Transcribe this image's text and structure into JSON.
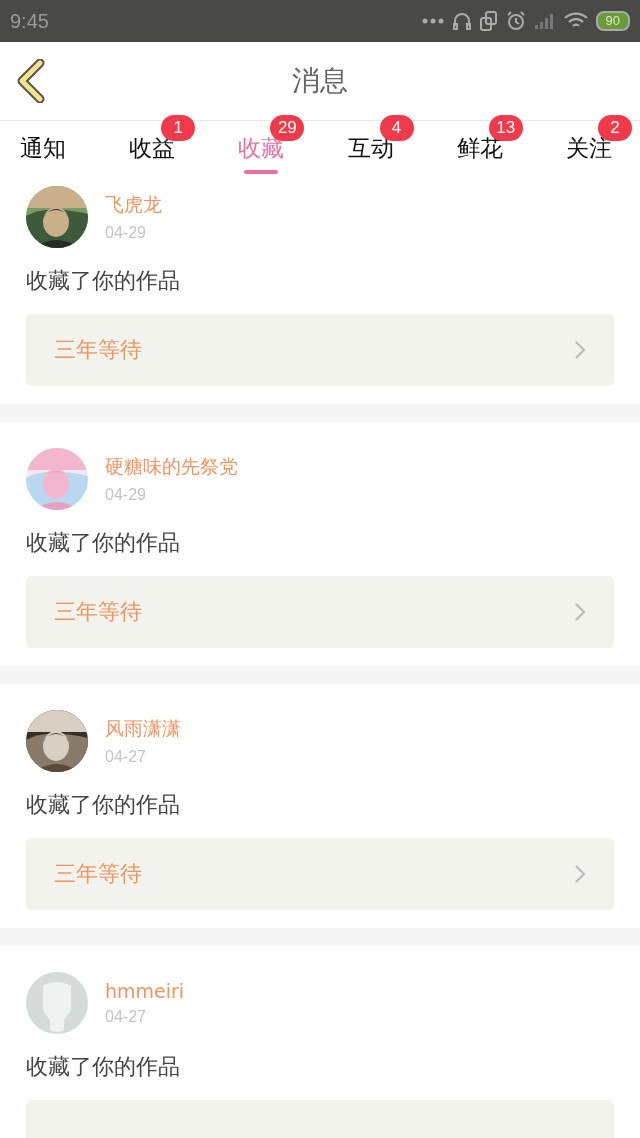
{
  "status_bar": {
    "time": "9:45",
    "battery": "90"
  },
  "header": {
    "title": "消息"
  },
  "tabs": [
    {
      "label": "通知",
      "selected": false
    },
    {
      "label": "收益",
      "selected": false,
      "badge": "1"
    },
    {
      "label": "收藏",
      "selected": true,
      "badge": "29"
    },
    {
      "label": "互动",
      "selected": false,
      "badge": "4"
    },
    {
      "label": "鲜花",
      "selected": false,
      "badge": "13"
    },
    {
      "label": "关注",
      "selected": false,
      "badge": "2"
    }
  ],
  "messages": [
    {
      "name": "飞虎龙",
      "date": "04-29",
      "text": "收藏了你的作品",
      "work": "三年等待"
    },
    {
      "name": "硬糖味的先祭党",
      "date": "04-29",
      "text": "收藏了你的作品",
      "work": "三年等待"
    },
    {
      "name": "风雨潇潇",
      "date": "04-27",
      "text": "收藏了你的作品",
      "work": "三年等待"
    },
    {
      "avatar": {
        "kind": "default"
      },
      "name": "hmmeiri",
      "date": "04-27",
      "text": "收藏了你的作品"
    }
  ]
}
